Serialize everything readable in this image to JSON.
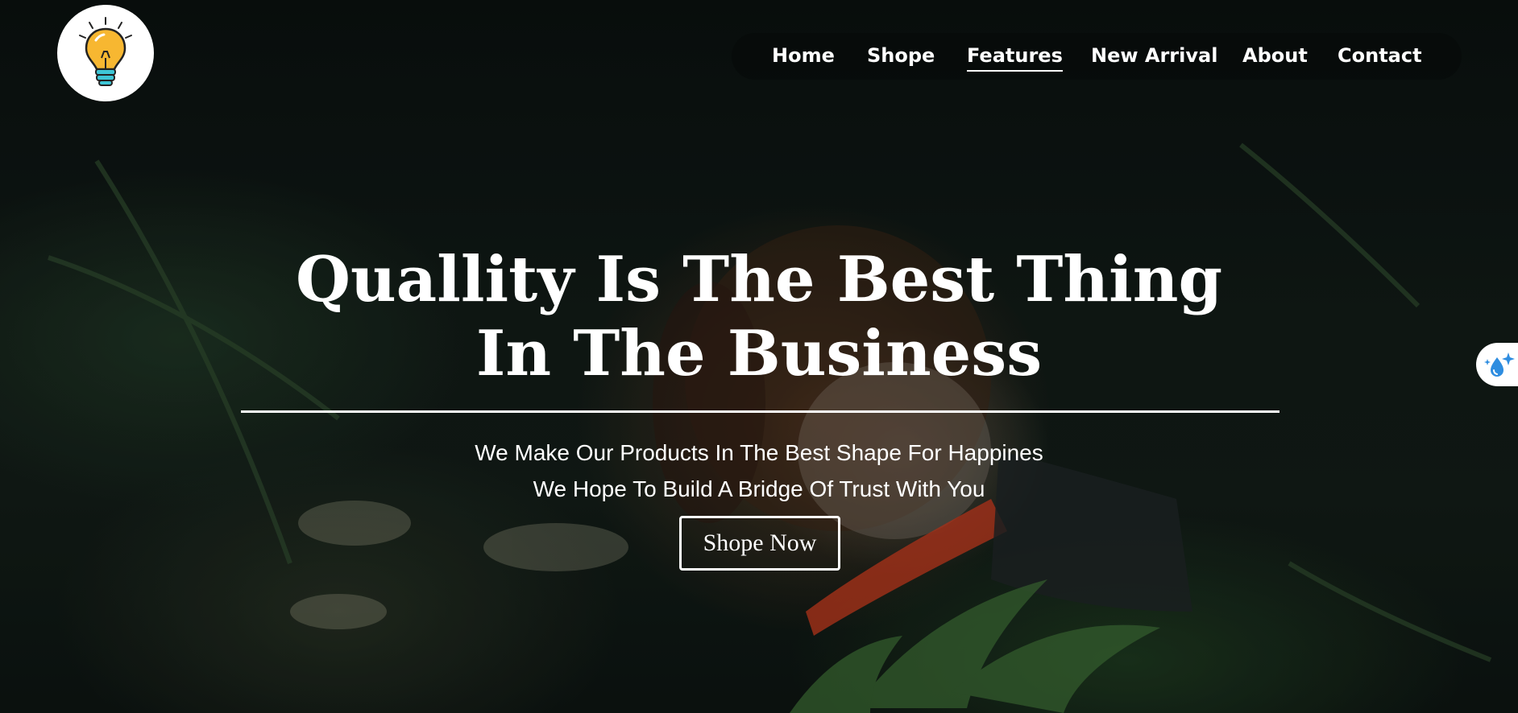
{
  "nav": {
    "items": [
      {
        "label": "Home",
        "active": false
      },
      {
        "label": "Shope",
        "active": false
      },
      {
        "label": "Features",
        "active": true
      },
      {
        "label": "New Arrival",
        "active": false
      },
      {
        "label": "About",
        "active": false
      },
      {
        "label": "Contact",
        "active": false
      }
    ]
  },
  "logo": {
    "icon": "lightbulb-icon"
  },
  "hero": {
    "headline_line1": "Quallity Is The Best Thing",
    "headline_line2": "In The Business",
    "subtext_line1": "We Make Our Products In The Best Shape For Happines",
    "subtext_line2": "We Hope To Build A Bridge Of Trust With You",
    "cta_label": "Shope Now"
  },
  "side_widget": {
    "icon": "water-drop-sparkle-icon"
  },
  "colors": {
    "text": "#ffffff",
    "nav_background": "#050a0a",
    "bulb": "#f7b731",
    "bulb_base": "#3ec6d6",
    "side_icon": "#2e8de0"
  }
}
